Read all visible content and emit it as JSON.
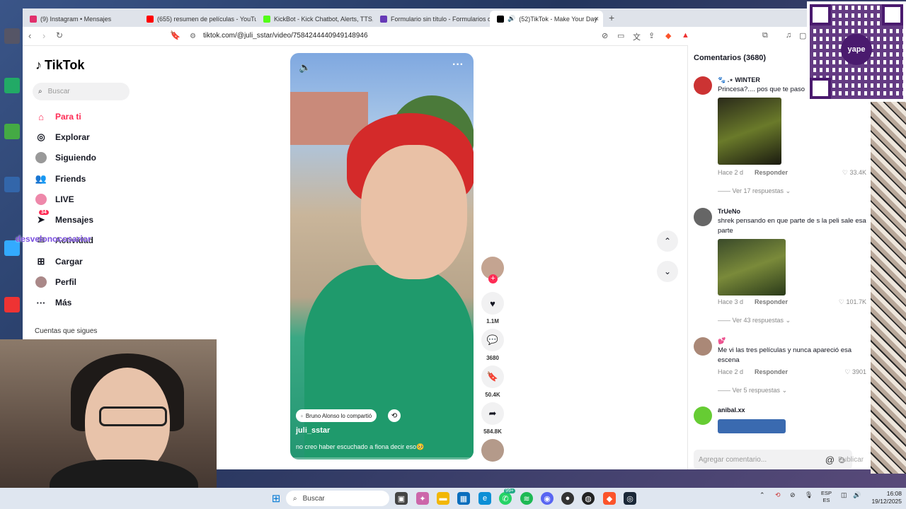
{
  "browser": {
    "tabs": [
      {
        "label": "(9) Instagram • Mensajes",
        "color": "#e1306c"
      },
      {
        "label": "(655) resumen de películas - YouTube",
        "color": "#ff0000"
      },
      {
        "label": "KickBot - Kick Chatbot, Alerts, TTS, O",
        "color": "#53fc18"
      },
      {
        "label": "Formulario sin título - Formularios de",
        "color": "#673ab7"
      },
      {
        "label": "(52)TikTok - Make Your Day",
        "color": "#000000"
      }
    ],
    "new_tab": "+",
    "close_tab": "×",
    "url": "tiktok.com/@juli_sstar/video/7584244440949148946"
  },
  "tiktok": {
    "logo": "TikTok",
    "search_placeholder": "Buscar",
    "nav": [
      {
        "label": "Para ti",
        "icon": "home-icon"
      },
      {
        "label": "Explorar",
        "icon": "compass-icon"
      },
      {
        "label": "Siguiendo",
        "icon": "following-icon"
      },
      {
        "label": "Friends",
        "icon": "friends-icon"
      },
      {
        "label": "LIVE",
        "icon": "live-icon"
      },
      {
        "label": "Mensajes",
        "icon": "messages-icon",
        "badge": "34"
      },
      {
        "label": "Actividad",
        "icon": "activity-icon"
      },
      {
        "label": "Cargar",
        "icon": "upload-icon"
      },
      {
        "label": "Perfil",
        "icon": "profile-icon"
      },
      {
        "label": "Más",
        "icon": "more-icon"
      }
    ],
    "following_header": "Cuentas que sigues",
    "overlay_name": "desvelonocosarior"
  },
  "video": {
    "shared_by": "Bruno Alonso lo compartió",
    "author": "juli_sstar",
    "caption": "no creo haber escuchado a fiona decir eso🥺",
    "likes": "1.1M",
    "comments": "3680",
    "saves": "50.4K",
    "shares": "584.8K",
    "progress": 0.02
  },
  "comments": {
    "title": "Comentarios (3680)",
    "items": [
      {
        "user": "🐾 .⋆ WINTER",
        "text": "Princesa?.... pos que te paso",
        "time": "Hace 2 d",
        "reply": "Responder",
        "likes": "33.4K",
        "replies": "Ver 17 respuestas"
      },
      {
        "user": "TrUeNo",
        "text": "shrek pensando en que parte de s la peli sale esa parte",
        "time": "Hace 3 d",
        "reply": "Responder",
        "likes": "101.7K",
        "replies": "Ver 43 respuestas"
      },
      {
        "user": "💕",
        "text": "Me vi las tres películas y nunca apareció esa escena",
        "time": "Hace 2 d",
        "reply": "Responder",
        "likes": "3901",
        "replies": "Ver 5 respuestas"
      },
      {
        "user": "anibal.xx",
        "text": "",
        "time": "",
        "reply": "",
        "likes": "",
        "replies": ""
      }
    ],
    "add_placeholder": "Agregar comentario...",
    "publish": "Publicar"
  },
  "qr": {
    "brand": "yape"
  },
  "taskbar": {
    "search": "Buscar",
    "lang": "ESP",
    "lang2": "ES",
    "time": "16:08",
    "date": "19/12/2025",
    "badge": "99+"
  }
}
